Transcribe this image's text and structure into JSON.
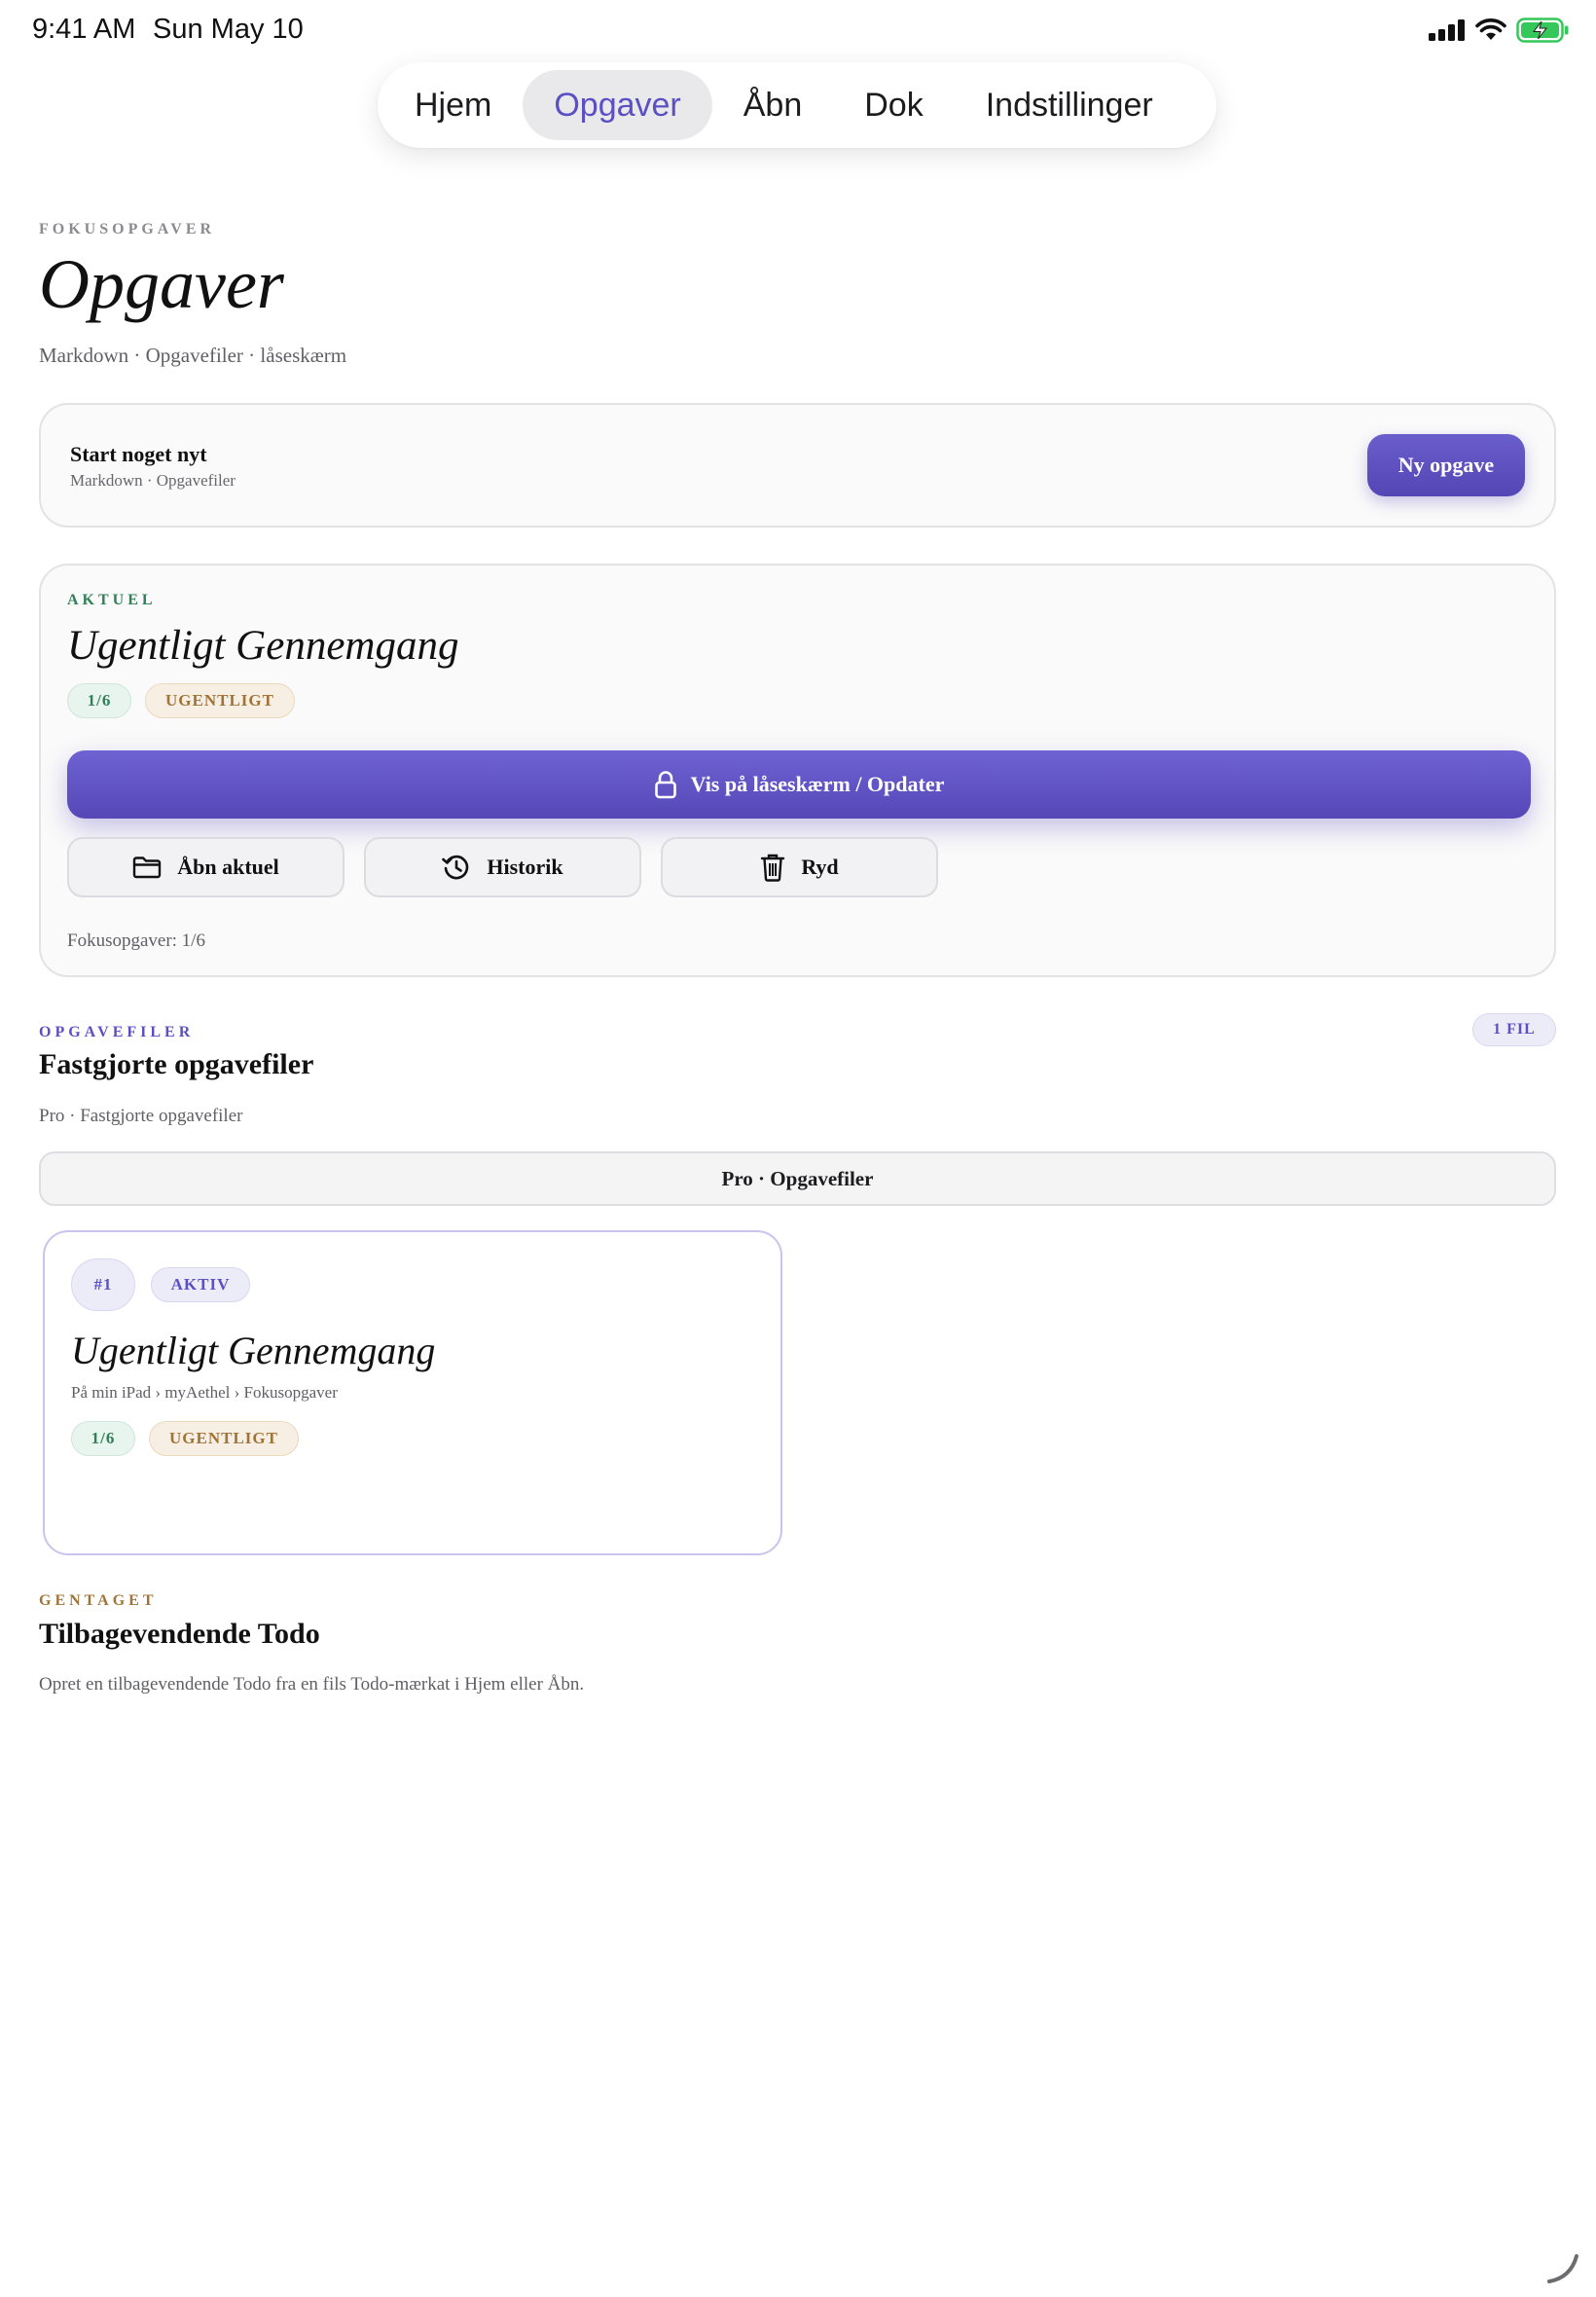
{
  "status_bar": {
    "time": "9:41 AM",
    "date": "Sun May 10",
    "battery_color": "#34c759"
  },
  "tabs": [
    {
      "label": "Hjem",
      "active": false
    },
    {
      "label": "Opgaver",
      "active": true
    },
    {
      "label": "Åbn",
      "active": false
    },
    {
      "label": "Dok",
      "active": false
    },
    {
      "label": "Indstillinger",
      "active": false
    }
  ],
  "header": {
    "eyebrow": "FOKUSOPGAVER",
    "title": "Opgaver",
    "subtitle": "Markdown · Opgavefiler · låseskærm"
  },
  "start_card": {
    "title": "Start noget nyt",
    "subtitle": "Markdown · Opgavefiler",
    "button_label": "Ny opgave"
  },
  "current_card": {
    "eyebrow": "AKTUEL",
    "title": "Ugentligt Gennemgang",
    "progress_chip": "1/6",
    "frequency_chip": "UGENTLIGT",
    "primary_button": "Vis på låseskærm / Opdater",
    "buttons": {
      "open": "Åbn aktuel",
      "history": "Historik",
      "clear": "Ryd"
    },
    "footer": "Fokusopgaver: 1/6"
  },
  "task_files": {
    "eyebrow": "OPGAVEFILER",
    "title": "Fastgjorte opgavefiler",
    "subtitle": "Pro · Fastgjorte opgavefiler",
    "count_badge": "1 FIL",
    "pro_bar": "Pro · Opgavefiler",
    "file": {
      "index": "#1",
      "status": "AKTIV",
      "title": "Ugentligt Gennemgang",
      "path": "På min iPad › myAethel › Fokusopgaver",
      "progress": "1/6",
      "frequency": "UGENTLIGT"
    }
  },
  "recurring": {
    "eyebrow": "GENTAGET",
    "title": "Tilbagevendende Todo",
    "description": "Opret en tilbagevendende Todo fra en fils Todo-mærkat i Hjem eller Åbn."
  },
  "colors": {
    "accent": "#5b4fc4",
    "green": "#2f7f57",
    "tan": "#a07438"
  }
}
